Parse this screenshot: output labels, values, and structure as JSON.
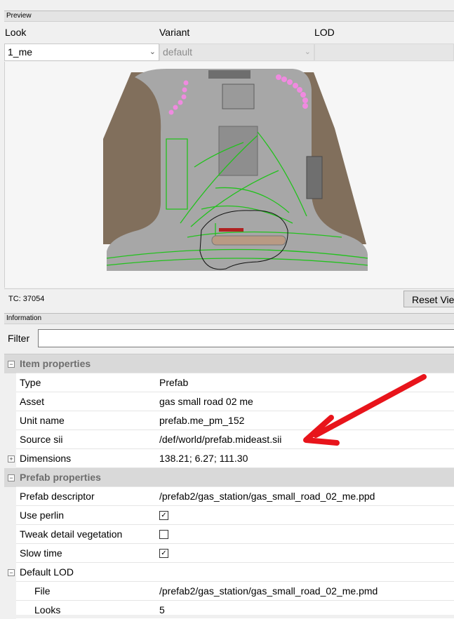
{
  "preview_panel": {
    "title": "Preview",
    "look_label": "Look",
    "variant_label": "Variant",
    "lod_label": "LOD",
    "look_value": "1_me",
    "variant_value": "default",
    "lod_value": "",
    "tc_text": "TC: 37054",
    "reset_view": "Reset View"
  },
  "info_panel": {
    "title": "Information",
    "filter_label": "Filter",
    "filter_value": ""
  },
  "properties": {
    "cat1": "Item properties",
    "type_name": "Type",
    "type_value": "Prefab",
    "asset_name": "Asset",
    "asset_value": "gas small road 02 me",
    "unit_name": "Unit name",
    "unit_value": "prefab.me_pm_152",
    "source_name": "Source sii",
    "source_value": "/def/world/prefab.mideast.sii",
    "dim_name": "Dimensions",
    "dim_value": "138.21; 6.27; 111.30",
    "cat2": "Prefab properties",
    "desc_name": "Prefab descriptor",
    "desc_value": "/prefab2/gas_station/gas_small_road_02_me.ppd",
    "perlin_name": "Use perlin",
    "perlin_checked": "✓",
    "tweak_name": "Tweak detail vegetation",
    "tweak_checked": "",
    "slow_name": "Slow time",
    "slow_checked": "✓",
    "lod_name": "Default LOD",
    "file_name": "File",
    "file_value": "/prefab2/gas_station/gas_small_road_02_me.pmd",
    "looks_name": "Looks",
    "looks_value": "5"
  },
  "colors": {
    "arrow": "#e8141b",
    "road_lines": "#22c21d",
    "dirt": "#7a6753"
  }
}
